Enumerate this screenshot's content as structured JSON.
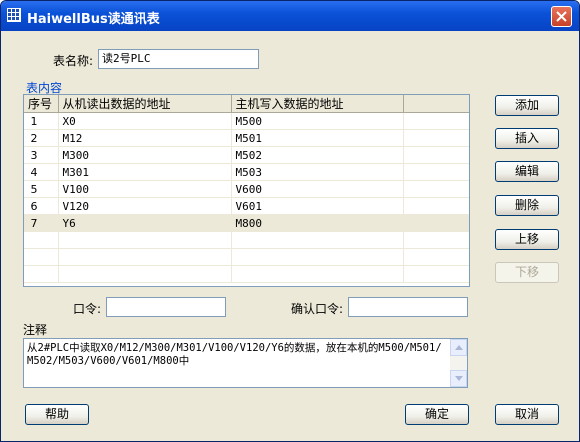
{
  "window": {
    "title": "HaiwellBus读通讯表",
    "close_icon": "close-icon",
    "app_icon": "grid-app-icon"
  },
  "form": {
    "table_name_label": "表名称:",
    "table_name_value": "读2号PLC",
    "group_label": "表内容",
    "password_label": "口令:",
    "password_value": "",
    "confirm_password_label": "确认口令:",
    "confirm_password_value": "",
    "notes_label": "注释",
    "notes_value": "从2#PLC中读取X0/M12/M300/M301/V100/V120/Y6的数据，放在本机的M500/M501/M502/M503/V600/V601/M800中"
  },
  "grid": {
    "columns": [
      "序号",
      "从机读出数据的地址",
      "主机写入数据的地址",
      ""
    ],
    "rows": [
      {
        "no": "1",
        "slave": "X0",
        "master": "M500"
      },
      {
        "no": "2",
        "slave": "M12",
        "master": "M501"
      },
      {
        "no": "3",
        "slave": "M300",
        "master": "M502"
      },
      {
        "no": "4",
        "slave": "M301",
        "master": "M503"
      },
      {
        "no": "5",
        "slave": "V100",
        "master": "V600"
      },
      {
        "no": "6",
        "slave": "V120",
        "master": "V601"
      },
      {
        "no": "7",
        "slave": "Y6",
        "master": "M800"
      }
    ],
    "selected_row": "7"
  },
  "side_buttons": {
    "add": "添加",
    "insert": "插入",
    "edit": "编辑",
    "delete": "删除",
    "move_up": "上移",
    "move_down": "下移"
  },
  "bottom_buttons": {
    "help": "帮助",
    "ok": "确定",
    "cancel": "取消"
  },
  "colors": {
    "titlebar": "#0a52d8",
    "dialog_bg": "#ece9d8",
    "group_title": "#0046d5",
    "disabled_text": "#aca899"
  }
}
